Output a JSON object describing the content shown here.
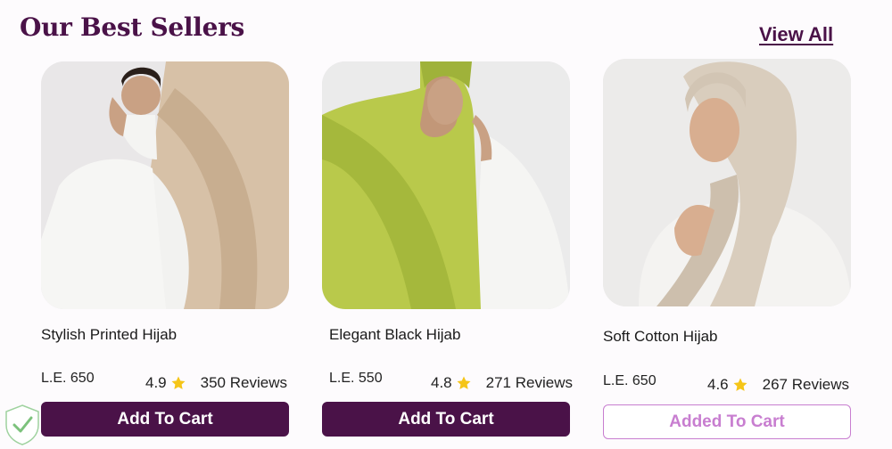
{
  "section": {
    "title": "Our Best Sellers",
    "view_all": "View All"
  },
  "colors": {
    "brand": "#4a1248",
    "added": "#c87ed0",
    "star": "#f5c518"
  },
  "products": [
    {
      "name": "Stylish Printed Hijab",
      "price": "L.E. 650",
      "rating": "4.9",
      "reviews": "350 Reviews",
      "button": "Add To Cart",
      "button_state": "add"
    },
    {
      "name": "Elegant Black Hijab",
      "price": "L.E. 550",
      "rating": "4.8",
      "reviews": "271 Reviews",
      "button": "Add To Cart",
      "button_state": "add"
    },
    {
      "name": "Soft Cotton Hijab",
      "price": "L.E. 650",
      "rating": "4.6",
      "reviews": "267 Reviews",
      "button": "Added To Cart",
      "button_state": "added"
    }
  ],
  "icons": {
    "rating": "star-icon",
    "corner_badge": "shield-check-badge-icon"
  }
}
